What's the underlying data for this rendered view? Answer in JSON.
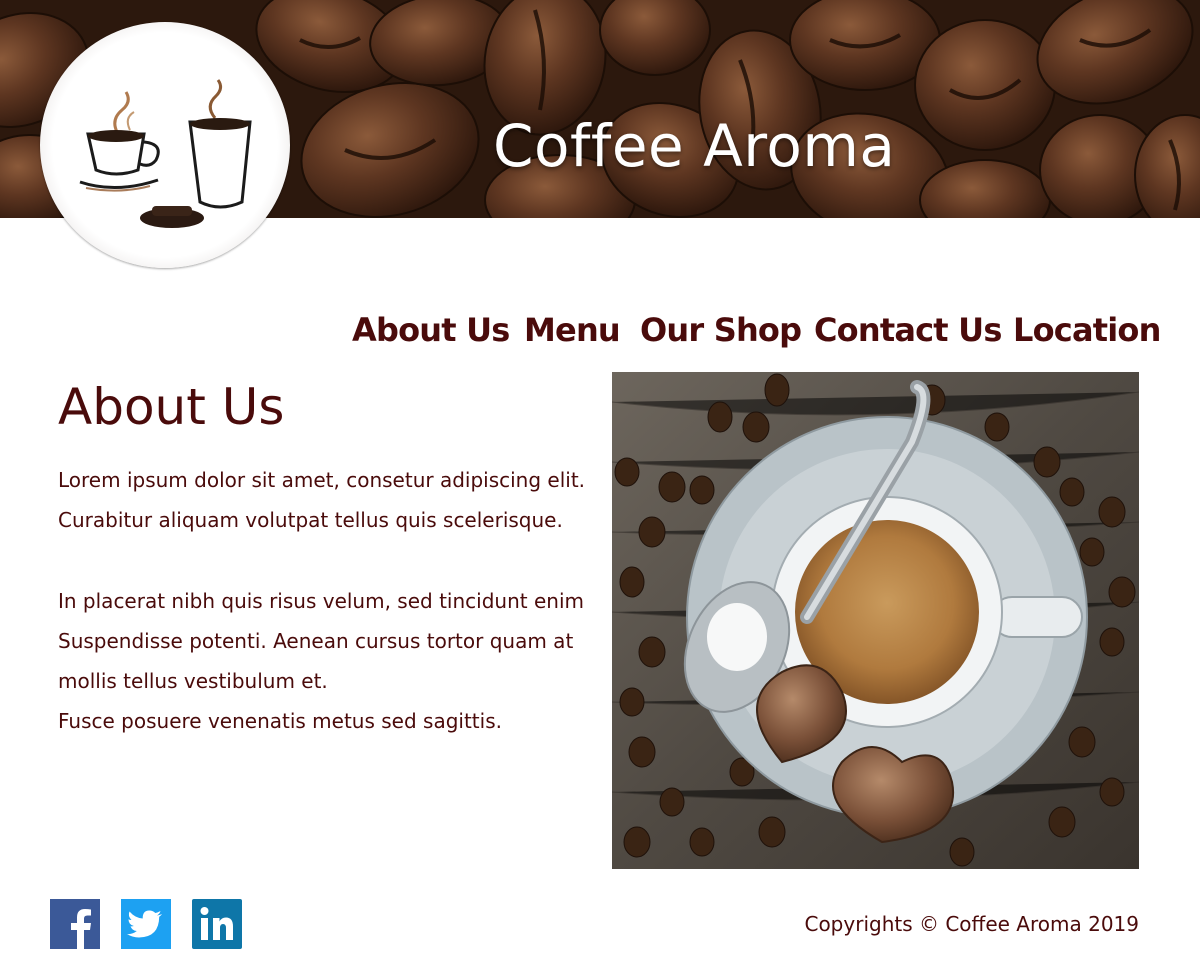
{
  "header": {
    "site_title": "Coffee Aroma",
    "banner_image": "coffee-beans-photo",
    "logo": "coffee-cups-logo"
  },
  "nav": {
    "items": [
      {
        "label": "About Us"
      },
      {
        "label": "Menu"
      },
      {
        "label": "Our Shop"
      },
      {
        "label": "Contact Us"
      },
      {
        "label": "Location"
      }
    ]
  },
  "main": {
    "heading": "About Us",
    "paragraph1": [
      "Lorem ipsum dolor sit amet, consetur adipiscing elit.",
      "Curabitur aliquam volutpat tellus quis scelerisque."
    ],
    "paragraph2": [
      "In placerat nibh quis risus velum, sed tincidunt enim",
      "Suspendisse potenti. Aenean cursus tortor quam at",
      "mollis tellus vestibulum et.",
      "Fusce posuere venenatis metus sed sagittis."
    ],
    "photo": "espresso-cup-with-chocolates-photo"
  },
  "footer": {
    "social": [
      {
        "name": "facebook-icon",
        "color": "#3b5998"
      },
      {
        "name": "twitter-icon",
        "color": "#1da1f2"
      },
      {
        "name": "linkedin-icon",
        "color": "#0e76a8"
      }
    ],
    "copyright": "Copyrights © Coffee Aroma 2019"
  },
  "colors": {
    "text": "#4a0b0b",
    "banner_dark": "#3a2114",
    "background": "#ffffff"
  }
}
